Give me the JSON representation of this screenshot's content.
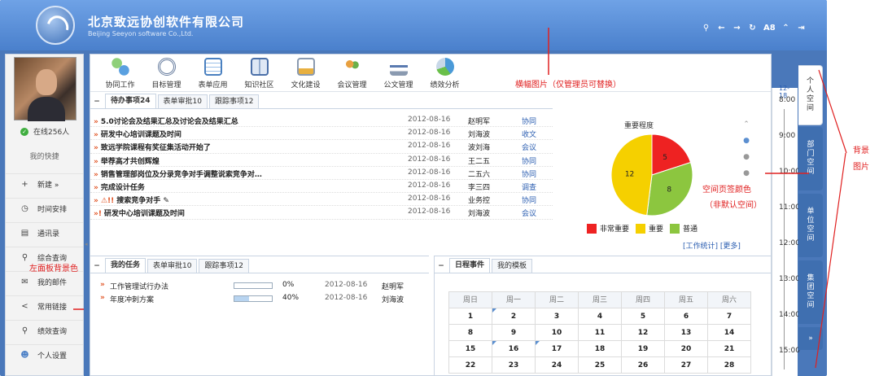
{
  "header": {
    "company_name": "北京致远协创软件有限公司",
    "company_en": "Beijing Seeyon software Co.,Ltd.",
    "icons": [
      "search-icon",
      "arrow-left-icon",
      "arrow-right-icon",
      "refresh-icon",
      "font-size-icon",
      "collapse-up-icon",
      "logout-icon"
    ],
    "font_size_label": "A8"
  },
  "sidebar": {
    "online": "在线256人",
    "quick_title": "我的快捷",
    "items": [
      {
        "label": "新建 »",
        "icon": "plus-icon"
      },
      {
        "label": "时间安排",
        "icon": "clock-icon"
      },
      {
        "label": "通讯录",
        "icon": "contacts-icon"
      },
      {
        "label": "综合查询",
        "icon": "search-icon"
      },
      {
        "label": "我的邮件",
        "icon": "mail-icon"
      },
      {
        "label": "常用链接",
        "icon": "share-icon"
      },
      {
        "label": "绩效查询",
        "icon": "search-icon"
      },
      {
        "label": "个人设置",
        "icon": "user-settings-icon"
      }
    ]
  },
  "toolbar": {
    "items": [
      "协同工作",
      "目标管理",
      "表单应用",
      "知识社区",
      "文化建设",
      "会议管理",
      "公文管理",
      "绩效分析"
    ]
  },
  "annotations": {
    "banner": "横幅图片（仅管理员可替换）",
    "tab_color": "空间页签颜色",
    "tab_color_sub": "（非默认空间）",
    "left_panel": "左面板背景色",
    "background": "背景图片"
  },
  "todo": {
    "tabs": [
      "待办事项24",
      "表单审批10",
      "跟踪事项12"
    ],
    "rows": [
      {
        "prefix": "»",
        "title": "5.0讨论会及结果汇总及讨论会及结果汇总",
        "date": "2012-08-16",
        "person": "赵明军",
        "type": "协同"
      },
      {
        "prefix": "»",
        "title": "研发中心培训课题及时间",
        "date": "2012-08-16",
        "person": "刘海波",
        "type": "收文"
      },
      {
        "prefix": "»",
        "title": "致远学院课程有奖征集活动开始了",
        "date": "2012-08-16",
        "person": "波刘海",
        "type": "会议"
      },
      {
        "prefix": "»",
        "title": "举荐高才共创辉煌",
        "date": "2012-08-16",
        "person": "王二五",
        "type": "协同"
      },
      {
        "prefix": "»",
        "title": "销售管理部岗位及分录竞争对手调整说索竞争对…",
        "date": "2012-08-16",
        "person": "二五六",
        "type": "协同"
      },
      {
        "prefix": "»",
        "title": "完成设计任务",
        "date": "2012-08-16",
        "person": "李三四",
        "type": "调查"
      },
      {
        "prefix": "» ⚠!!",
        "title": "搜索竞争对手",
        "date": "2012-08-16",
        "person": "业务控",
        "type": "协同"
      },
      {
        "prefix": "»!",
        "title": "研发中心培训课题及时间",
        "date": "2012-08-16",
        "person": "刘海波",
        "type": "会议"
      }
    ],
    "links": "[工作统计]  [更多]"
  },
  "chart_data": {
    "type": "pie",
    "title": "重要程度",
    "categories": [
      "非常重要",
      "重要",
      "普通"
    ],
    "values": [
      5,
      12,
      8
    ],
    "colors": [
      "#ee2222",
      "#f5d000",
      "#8cc63f"
    ]
  },
  "tasks": {
    "tabs": [
      "我的任务",
      "表单审批10",
      "跟踪事项12"
    ],
    "rows": [
      {
        "title": "工作管理试行办法",
        "progress": 0,
        "pct": "0%",
        "date": "2012-08-16",
        "person": "赵明军"
      },
      {
        "title": "年度冲刺方案",
        "progress": 0.4,
        "pct": "40%",
        "date": "2012-08-16",
        "person": "刘海波"
      }
    ]
  },
  "calendar": {
    "tabs": [
      "日程事件",
      "我的模板"
    ],
    "weekdays": [
      "周日",
      "周一",
      "周二",
      "周三",
      "周四",
      "周五",
      "周六"
    ],
    "weeks": [
      [
        "1",
        "2",
        "3",
        "4",
        "5",
        "6",
        "7"
      ],
      [
        "8",
        "9",
        "10",
        "11",
        "12",
        "13",
        "14"
      ],
      [
        "15",
        "16",
        "17",
        "18",
        "19",
        "20",
        "21"
      ],
      [
        "22",
        "23",
        "24",
        "25",
        "26",
        "27",
        "28"
      ]
    ],
    "marked": [
      "2",
      "16",
      "17"
    ]
  },
  "timeline": {
    "date": "12-18",
    "hours": [
      "8:00",
      "9:00",
      "10:00",
      "11:00",
      "12:00",
      "13:00",
      "14:00",
      "15:00"
    ]
  },
  "space_tabs": [
    "个人空间",
    "部门空间",
    "单位空间",
    "集团空间",
    "»"
  ]
}
